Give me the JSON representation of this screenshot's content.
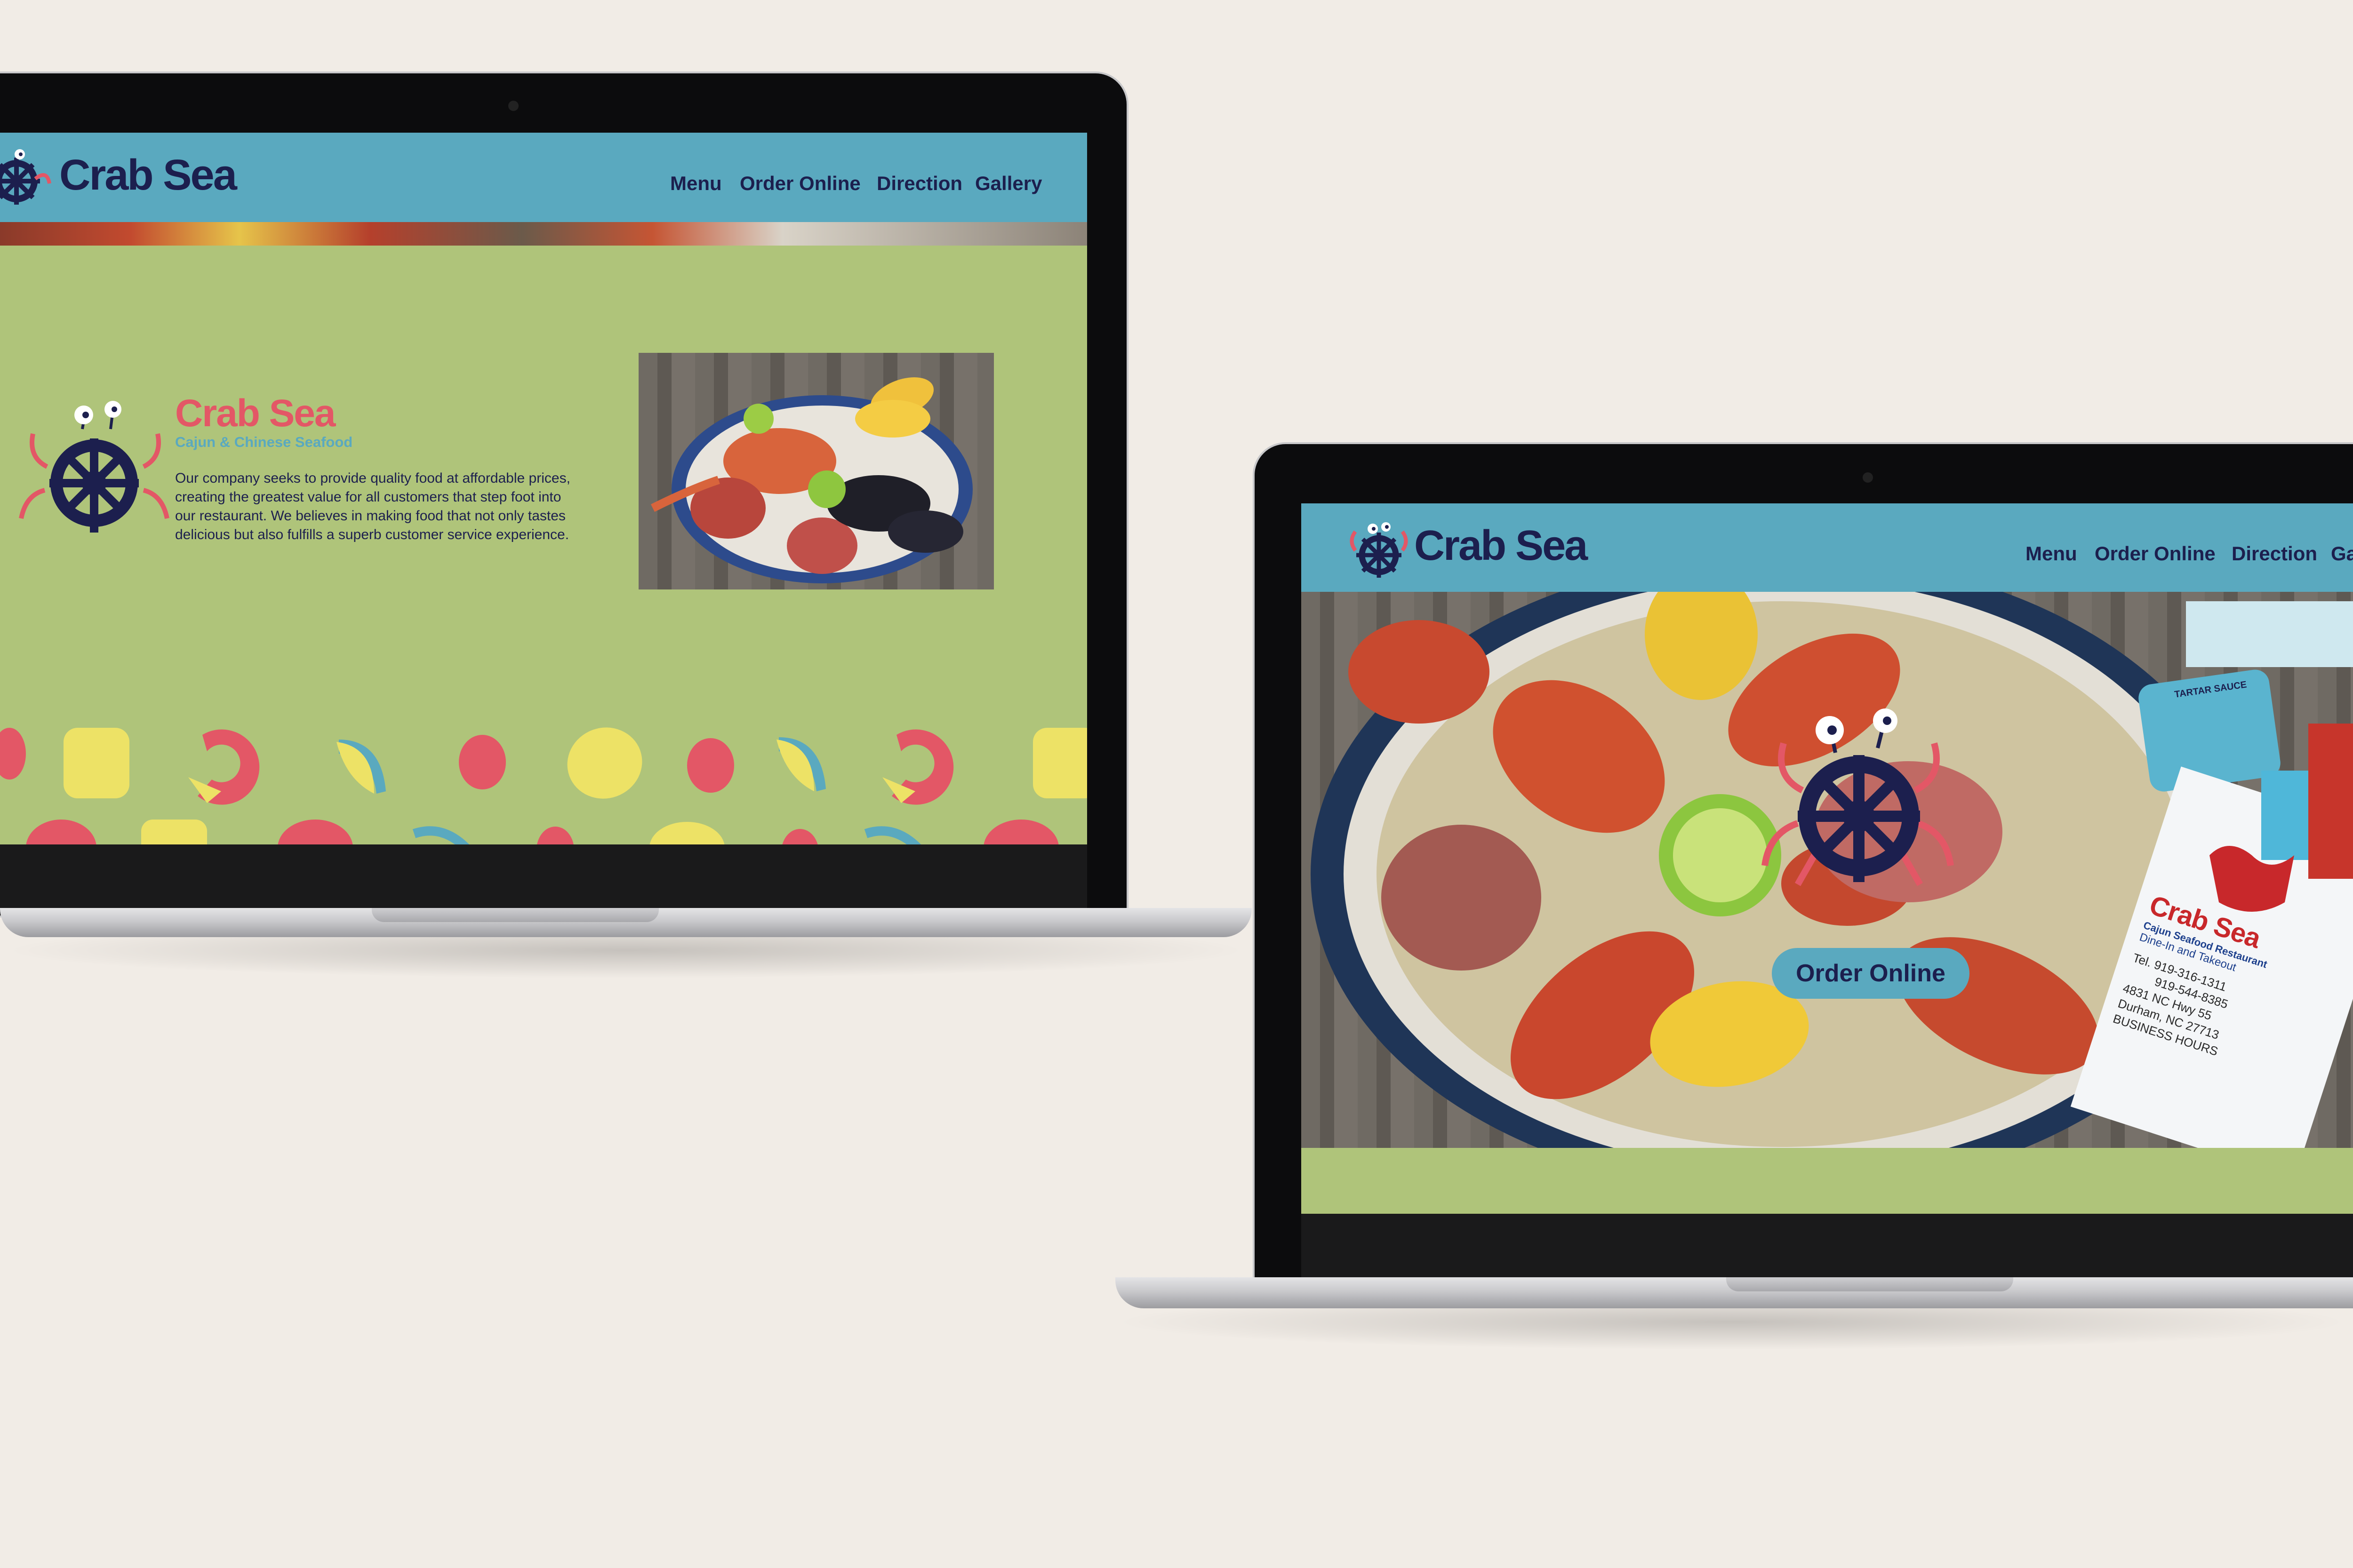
{
  "site": {
    "brand_name": "Crab Sea",
    "nav_items": [
      "Menu",
      "Order Online",
      "Direction",
      "Gallery"
    ],
    "nav_items_right_visible": [
      "Menu",
      "Order Online",
      "Direction",
      "Ga"
    ]
  },
  "about": {
    "title": "Crab Sea",
    "subtitle": "Cajun & Chinese Seafood",
    "body_lines": [
      "Our company seeks to provide quality food at affordable prices,",
      "creating the greatest value for all customers that step foot into",
      "our restaurant. We believes in making food that not only tastes",
      "delicious but also fulfills a superb customer service experience."
    ]
  },
  "hero": {
    "cta_label": "Order Online"
  },
  "menu_card": {
    "brand": "Crab Sea",
    "tagline": "Cajun Seafood Restaurant",
    "service": "Dine-In and Takeout",
    "lines": [
      "Tel. 919-316-1311",
      "919-544-8385",
      "4831 NC Hwy 55",
      "Durham, NC 27713",
      "BUSINESS HOURS"
    ]
  },
  "sauce_label": "TARTAR SAUCE",
  "colors": {
    "nav_bg": "#5aa9bf",
    "brand_navy": "#1c1f4e",
    "accent_red": "#e35766",
    "page_green": "#afc47a",
    "shape_yellow": "#ede266"
  }
}
